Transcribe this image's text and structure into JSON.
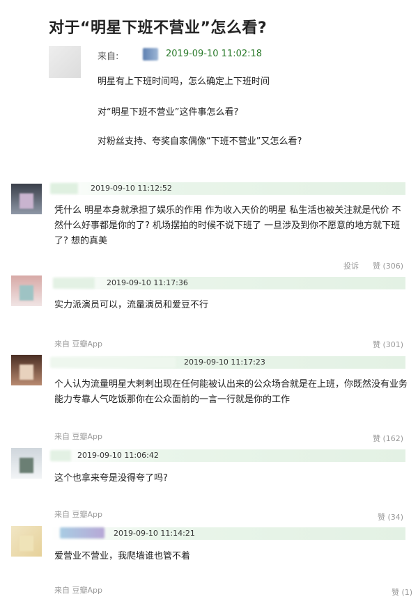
{
  "post": {
    "title": "对于“明星下班不营业”怎么看?",
    "from_label": "来自:",
    "timestamp": "2019-09-10 11:02:18",
    "lines": [
      "明星有上下班时间吗，怎么确定上下班时间",
      "对“明星下班不营业”这件事怎么看?",
      "对粉丝支持、夸奖自家偶像“下班不营业”又怎么看?"
    ]
  },
  "comments": [
    {
      "time": "2019-09-10 11:12:52",
      "text": "凭什么 明星本身就承担了娱乐的作用 作为收入天价的明星 私生活也被关注就是代价 不然什么好事都是你的了? 机场摆拍的时候不说下班了 一旦涉及到你不愿意的地方就下班了? 想的真美",
      "report_label": "投诉",
      "like_label": "赞",
      "likes": "(306)",
      "source": ""
    },
    {
      "time": "2019-09-10 11:17:36",
      "text": "实力派演员可以，流量演员和爱豆不行",
      "report_label": "",
      "like_label": "赞",
      "likes": "(301)",
      "source": "来自 豆瓣App"
    },
    {
      "time": "2019-09-10 11:17:23",
      "text": "个人认为流量明星大剌剌出现在任何能被认出来的公众场合就是在上班，你既然没有业务能力专靠人气吃饭那你在公众面前的一言一行就是你的工作",
      "report_label": "",
      "like_label": "赞",
      "likes": "(162)",
      "source": "来自 豆瓣App"
    },
    {
      "time": "2019-09-10 11:06:42",
      "text": "这个也拿来夸是没得夸了吗?",
      "report_label": "",
      "like_label": "赞",
      "likes": "(34)",
      "source": "来自 豆瓣App"
    },
    {
      "time": "2019-09-10 11:14:21",
      "text": "爱营业不营业，我爬墙谁也管不着",
      "report_label": "",
      "like_label": "赞",
      "likes": "(1)",
      "source": "来自 豆瓣App"
    }
  ],
  "colors": {
    "timestamp_green": "#2a7a2a",
    "meta_gray": "#999999",
    "header_bar_green": "#e3f1e4"
  }
}
